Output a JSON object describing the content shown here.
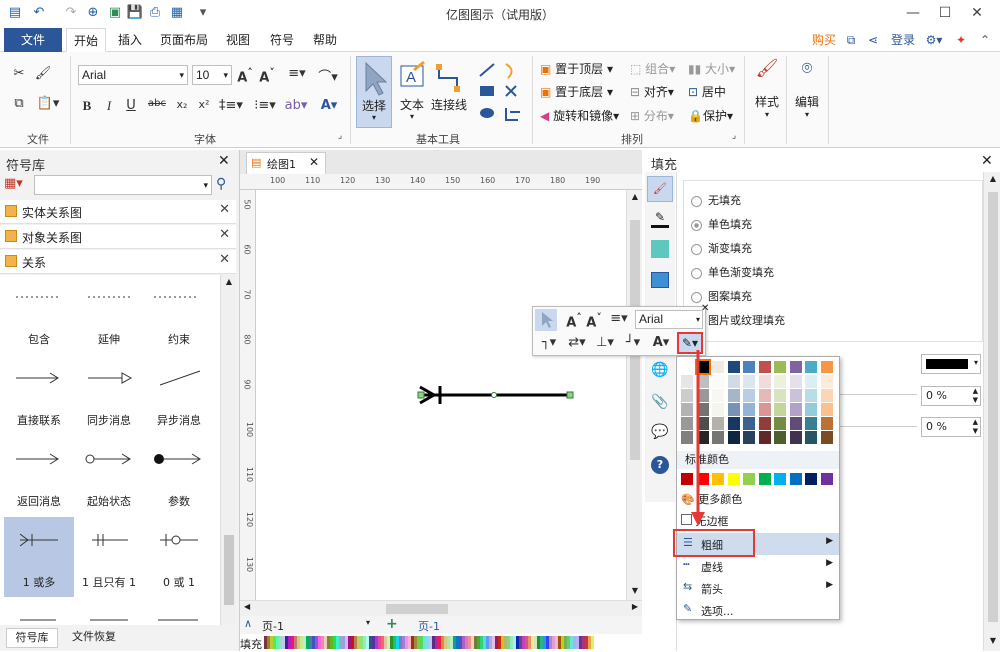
{
  "app": {
    "title": "亿图图示（试用版）"
  },
  "menu": {
    "file": "文件",
    "home": "开始",
    "insert": "插入",
    "layout": "页面布局",
    "view": "视图",
    "symbol": "符号",
    "help": "帮助",
    "buy": "购买",
    "login": "登录"
  },
  "ribbon": {
    "font_name": "Arial",
    "font_size": "10",
    "group_file": "文件",
    "group_font": "字体",
    "group_basic": "基本工具",
    "group_arrange": "排列",
    "select": "选择",
    "text": "文本",
    "connector": "连接线",
    "bring_front": "置于顶层",
    "send_back": "置于底层",
    "rotate_mirror": "旋转和镜像",
    "group": "组合",
    "align": "对齐",
    "distribute": "分布",
    "size": "大小",
    "center": "居中",
    "protect": "保护",
    "style": "样式",
    "edit": "编辑"
  },
  "library": {
    "title": "符号库",
    "items": [
      "实体关系图",
      "对象关系图",
      "关系"
    ],
    "symbols": [
      "包含",
      "延伸",
      "约束",
      "直接联系",
      "同步消息",
      "异步消息",
      "返回消息",
      "起始状态",
      "参数",
      "1 或多",
      "1 且只有 1",
      "0 或 1"
    ],
    "tabs": [
      "符号库",
      "文件恢复"
    ]
  },
  "doc": {
    "tab": "绘图1",
    "page": "页-1",
    "page_tab": "页-1",
    "fill_label": "填充"
  },
  "ruler": {
    "h": [
      "100",
      "110",
      "120",
      "130",
      "140",
      "150",
      "160",
      "170",
      "180",
      "190"
    ],
    "v": [
      "50",
      "60",
      "70",
      "80",
      "90",
      "100",
      "110",
      "120",
      "130"
    ]
  },
  "minitoolbar": {
    "font": "Arial"
  },
  "fill_panel": {
    "title": "填充",
    "options": [
      "无填充",
      "单色填充",
      "渐变填充",
      "单色渐变填充",
      "图案填充",
      "图片或纹理填充"
    ],
    "selected": "单色填充",
    "pct1": "0 %",
    "pct2": "0 %"
  },
  "color_menu": {
    "standard": "标准颜色",
    "more_colors": "更多颜色",
    "no_border": "无边框",
    "weight": "粗细",
    "dash": "虚线",
    "arrow": "箭头",
    "options": "选项..."
  },
  "colors": {
    "accent": "#2b579a",
    "highlight": "#e53935",
    "selected_bg": "#b8c8e4"
  }
}
